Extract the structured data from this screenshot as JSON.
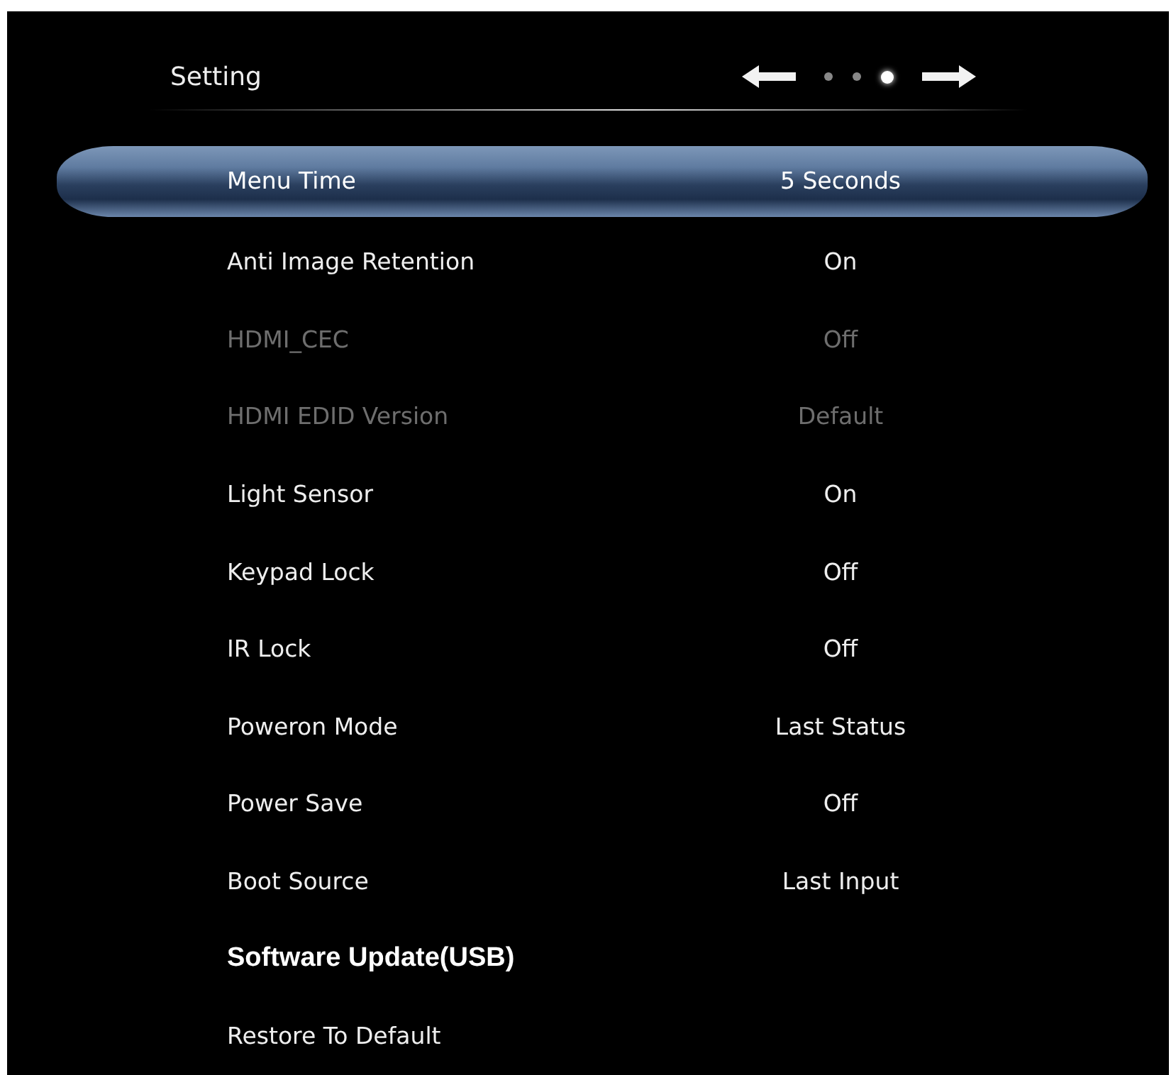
{
  "header": {
    "title": "Setting",
    "pages": [
      {
        "selected": false
      },
      {
        "selected": false
      },
      {
        "selected": true
      }
    ]
  },
  "rows": [
    {
      "label": "Menu Time",
      "value": "5 Seconds",
      "selected": true,
      "disabled": false,
      "emphasized": false
    },
    {
      "label": "Anti Image Retention",
      "value": "On",
      "selected": false,
      "disabled": false,
      "emphasized": false
    },
    {
      "label": "HDMI_CEC",
      "value": "Off",
      "selected": false,
      "disabled": true,
      "emphasized": false
    },
    {
      "label": "HDMI EDID Version",
      "value": "Default",
      "selected": false,
      "disabled": true,
      "emphasized": false
    },
    {
      "label": "Light Sensor",
      "value": "On",
      "selected": false,
      "disabled": false,
      "emphasized": false
    },
    {
      "label": "Keypad Lock",
      "value": "Off",
      "selected": false,
      "disabled": false,
      "emphasized": false
    },
    {
      "label": "IR Lock",
      "value": "Off",
      "selected": false,
      "disabled": false,
      "emphasized": false
    },
    {
      "label": "Poweron Mode",
      "value": "Last Status",
      "selected": false,
      "disabled": false,
      "emphasized": false
    },
    {
      "label": "Power Save",
      "value": "Off",
      "selected": false,
      "disabled": false,
      "emphasized": false
    },
    {
      "label": "Boot Source",
      "value": "Last Input",
      "selected": false,
      "disabled": false,
      "emphasized": false
    },
    {
      "label": "Software Update(USB)",
      "selected": false,
      "disabled": false,
      "emphasized": true
    },
    {
      "label": "Restore To Default",
      "selected": false,
      "disabled": false,
      "emphasized": false
    }
  ]
}
